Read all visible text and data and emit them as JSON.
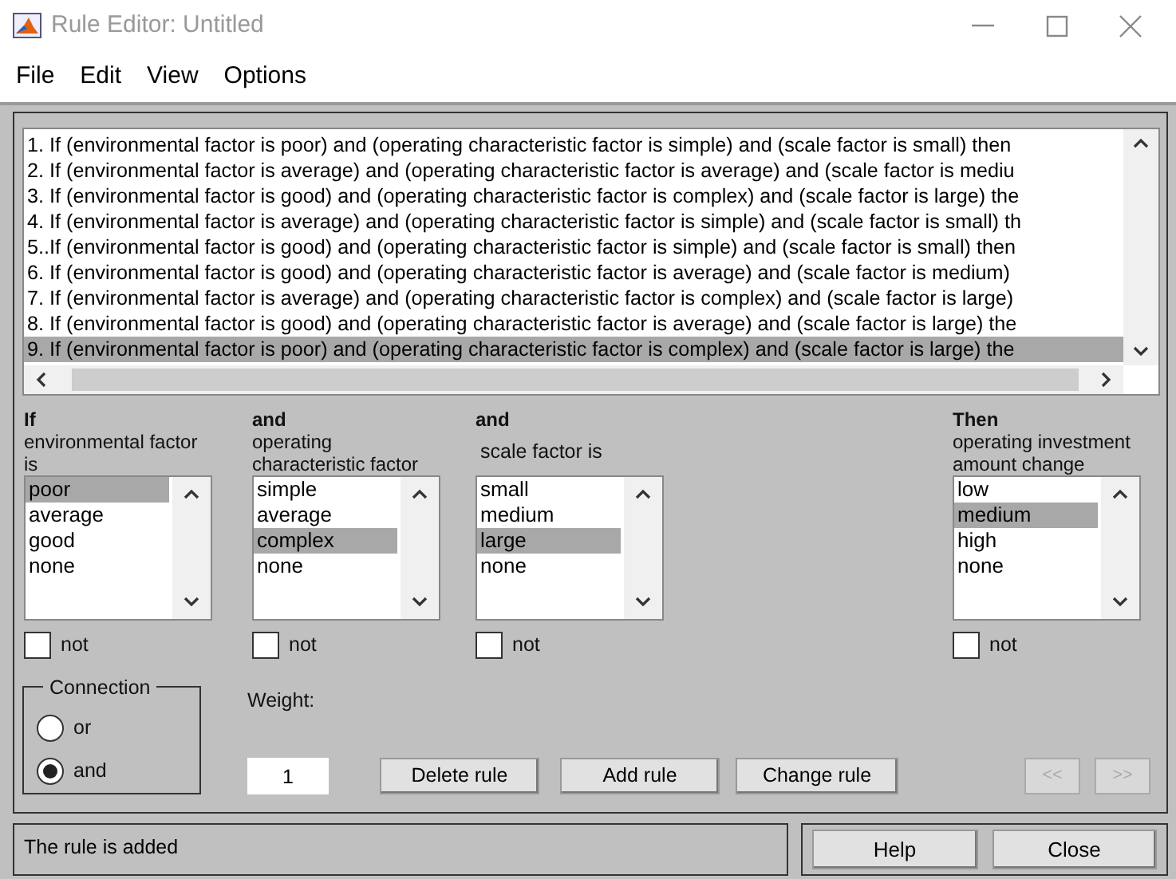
{
  "window": {
    "title": "Rule Editor: Untitled"
  },
  "menu": [
    "File",
    "Edit",
    "View",
    "Options"
  ],
  "rules": [
    {
      "text": "1. If (environmental factor is poor) and (operating characteristic factor is simple) and (scale factor is small) then",
      "selected": false
    },
    {
      "text": "2. If (environmental factor is average) and (operating characteristic factor is average) and (scale factor is mediu",
      "selected": false
    },
    {
      "text": "3. If (environmental factor is good) and (operating characteristic factor is complex) and (scale factor is large) the",
      "selected": false
    },
    {
      "text": "4. If (environmental factor is average) and (operating characteristic factor is simple) and (scale factor is small) th",
      "selected": false
    },
    {
      "text": "5..If (environmental factor is good) and (operating characteristic factor is simple) and (scale factor is small) then",
      "selected": false
    },
    {
      "text": "6. If (environmental factor is good) and (operating characteristic factor is average) and (scale factor is medium)",
      "selected": false
    },
    {
      "text": "7. If (environmental factor is average) and (operating characteristic factor is complex) and (scale factor is large)",
      "selected": false
    },
    {
      "text": "8. If (environmental factor is good) and (operating characteristic factor is average) and (scale factor is large) the",
      "selected": false
    },
    {
      "text": "9. If (environmental factor is poor) and (operating characteristic factor is complex) and (scale factor is large) the",
      "selected": true
    }
  ],
  "columns": [
    {
      "header": [
        "If",
        "environmental factor",
        "is"
      ],
      "items": [
        {
          "label": "poor",
          "selected": true
        },
        {
          "label": "average",
          "selected": false
        },
        {
          "label": "good",
          "selected": false
        },
        {
          "label": "none",
          "selected": false
        }
      ],
      "not": {
        "label": "not",
        "checked": false
      }
    },
    {
      "header": [
        "and",
        "operating",
        "characteristic factor"
      ],
      "items": [
        {
          "label": "simple",
          "selected": false
        },
        {
          "label": "average",
          "selected": false
        },
        {
          "label": "complex",
          "selected": true
        },
        {
          "label": "none",
          "selected": false
        }
      ],
      "not": {
        "label": "not",
        "checked": false
      }
    },
    {
      "header": [
        "and",
        "scale factor is"
      ],
      "items": [
        {
          "label": "small",
          "selected": false
        },
        {
          "label": "medium",
          "selected": false
        },
        {
          "label": "large",
          "selected": true
        },
        {
          "label": "none",
          "selected": false
        }
      ],
      "not": {
        "label": "not",
        "checked": false
      }
    },
    {
      "header": [
        "Then",
        "operating investment",
        "amount change"
      ],
      "items": [
        {
          "label": "low",
          "selected": false
        },
        {
          "label": "medium",
          "selected": true
        },
        {
          "label": "high",
          "selected": false
        },
        {
          "label": "none",
          "selected": false
        }
      ],
      "not": {
        "label": "not",
        "checked": false
      }
    }
  ],
  "connection": {
    "title": "Connection",
    "options": [
      {
        "label": "or",
        "selected": false
      },
      {
        "label": "and",
        "selected": true
      }
    ]
  },
  "weight": {
    "label": "Weight:",
    "value": "1"
  },
  "actions": [
    {
      "label": "Delete rule"
    },
    {
      "label": "Add rule"
    },
    {
      "label": "Change rule"
    }
  ],
  "nav": [
    {
      "label": "<<",
      "disabled": true
    },
    {
      "label": ">>",
      "disabled": true
    }
  ],
  "status": "The rule is added",
  "footer_buttons": [
    "Help",
    "Close"
  ]
}
